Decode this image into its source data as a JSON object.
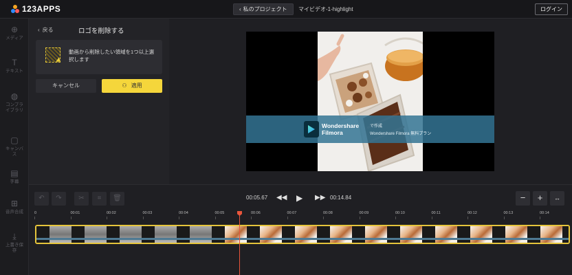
{
  "header": {
    "logo_text": "123APPS",
    "back_project_label": "私のプロジェクト",
    "project_name": "マイビデオ-1-highlight",
    "login_label": "ログイン"
  },
  "rail": {
    "items": [
      {
        "icon": "add-media-icon",
        "glyph": "⊕",
        "label": "メディア"
      },
      {
        "icon": "text-icon",
        "glyph": "T",
        "label": "テキスト"
      },
      {
        "icon": "sticker-icon",
        "glyph": "◍",
        "label": "コンプライブラリ"
      },
      {
        "icon": "canvas-icon",
        "glyph": "▢",
        "label": "キャンバス"
      },
      {
        "icon": "subtitles-icon",
        "glyph": "▤",
        "label": "字幕"
      },
      {
        "icon": "voice-icon",
        "glyph": "⊞",
        "label": "音声合成"
      },
      {
        "icon": "download-icon",
        "glyph": "⤓",
        "label": "上書き保存"
      }
    ]
  },
  "panel": {
    "back_label": "戻る",
    "title": "ロゴを削除する",
    "info_text": "動画から削除したい領域を1つ以上選択します",
    "cancel_label": "キャンセル",
    "apply_label": "適用"
  },
  "watermark": {
    "brand_line1": "Wondershare",
    "brand_line2": "Filmora",
    "made_with": "で作成",
    "plan_text": "Wondershare Filmora 無料プラン"
  },
  "playback": {
    "current_time": "00:05.67",
    "total_time": "00:14.84"
  },
  "ruler": {
    "ticks": [
      "0",
      "00:01",
      "00:02",
      "00:03",
      "00:04",
      "00:05",
      "00:06",
      "00:07",
      "00:08",
      "00:09",
      "00:10",
      "00:11",
      "00:12",
      "00:13",
      "00:14"
    ]
  },
  "colors": {
    "accent": "#f5d63b",
    "playhead": "#e8553b",
    "watermark_band": "#347494"
  }
}
